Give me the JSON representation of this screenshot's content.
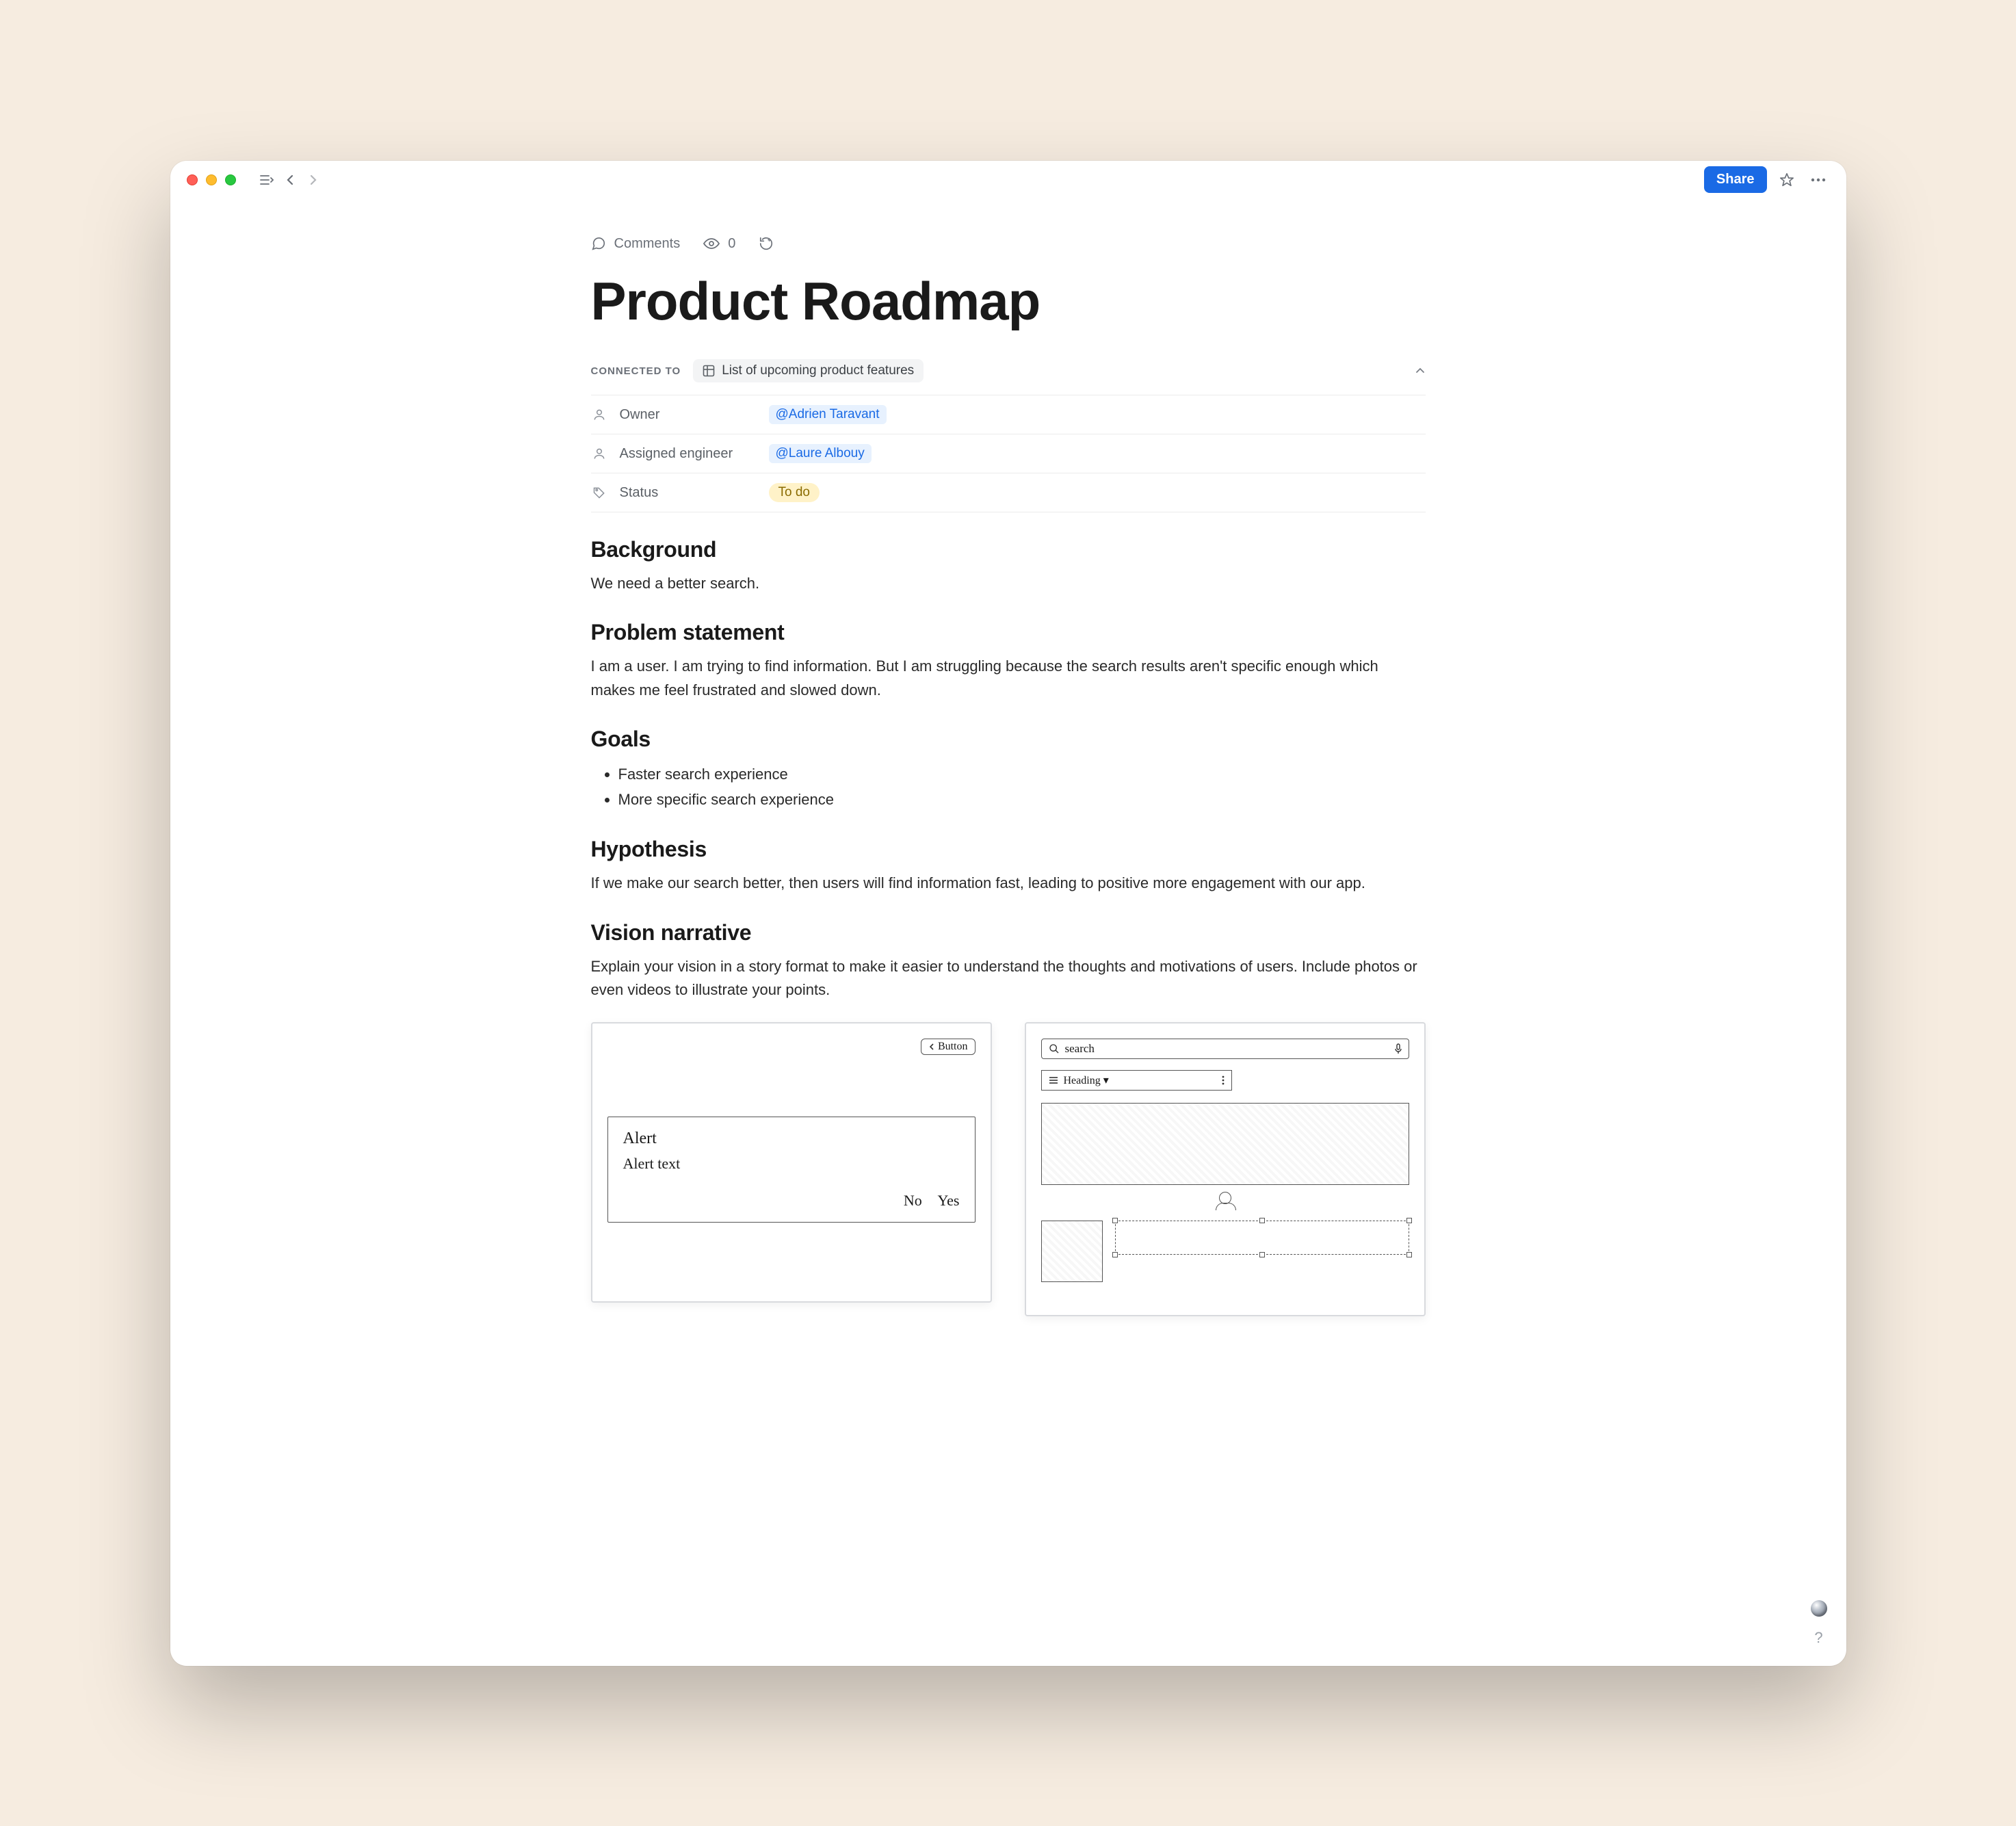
{
  "toolbar": {
    "share_label": "Share",
    "comments_label": "Comments",
    "view_count": "0"
  },
  "page": {
    "title": "Product Roadmap",
    "connected_label": "Connected to",
    "connected_value": "List of upcoming product features"
  },
  "properties": {
    "owner": {
      "label": "Owner",
      "value": "@Adrien Taravant"
    },
    "engineer": {
      "label": "Assigned engineer",
      "value": "@Laure Albouy"
    },
    "status": {
      "label": "Status",
      "value": "To do"
    }
  },
  "sections": {
    "background": {
      "heading": "Background",
      "body": "We need a better search."
    },
    "problem": {
      "heading": "Problem statement",
      "body": "I am a user. I am trying to find information. But I am struggling because the search results aren't specific enough which makes me feel frustrated and slowed down."
    },
    "goals": {
      "heading": "Goals",
      "items": [
        "Faster search experience",
        "More specific search experience"
      ]
    },
    "hypothesis": {
      "heading": "Hypothesis",
      "body": "If we make our search better, then users will find information fast, leading to positive more engagement with our app."
    },
    "vision": {
      "heading": "Vision narrative",
      "body": "Explain your vision in a story format to make it easier to understand the thoughts and motivations of users. Include photos or even videos to illustrate your points."
    }
  },
  "mockups": {
    "left": {
      "button": "Button",
      "title": "Alert",
      "text": "Alert text",
      "no": "No",
      "yes": "Yes"
    },
    "right": {
      "search": "search",
      "heading": "Heading"
    }
  },
  "help_glyph": "?"
}
